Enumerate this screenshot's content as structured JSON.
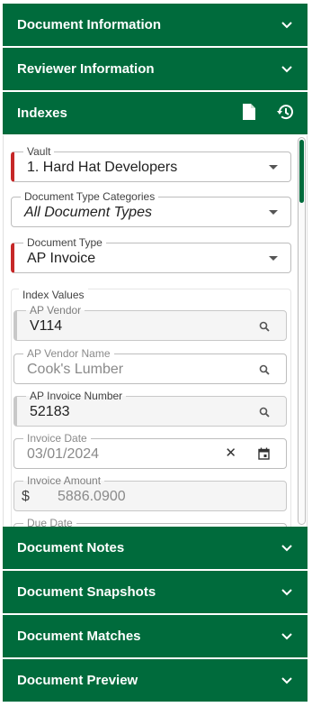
{
  "panels": {
    "document_information": "Document Information",
    "reviewer_information": "Reviewer Information",
    "indexes": "Indexes",
    "document_notes": "Document Notes",
    "document_snapshots": "Document Snapshots",
    "document_matches": "Document Matches",
    "document_preview": "Document Preview"
  },
  "colors": {
    "header_bg": "#006b3c",
    "required_marker": "#c62828"
  },
  "form": {
    "vault": {
      "label": "Vault",
      "value": "1. Hard Hat Developers"
    },
    "doc_type_categories": {
      "label": "Document Type Categories",
      "value": "All Document Types"
    },
    "doc_type": {
      "label": "Document Type",
      "value": "AP Invoice"
    },
    "index_values_label": "Index Values",
    "ap_vendor": {
      "label": "AP Vendor",
      "value": "V114"
    },
    "ap_vendor_name": {
      "label": "AP Vendor Name",
      "value": "Cook's Lumber"
    },
    "ap_invoice_number": {
      "label": "AP Invoice Number",
      "value": "52183"
    },
    "invoice_date": {
      "label": "Invoice Date",
      "value": "03/01/2024",
      "clear": "✕"
    },
    "invoice_amount": {
      "label": "Invoice Amount",
      "currency": "$",
      "value": "5886.0900"
    },
    "due_date": {
      "label": "Due Date"
    }
  }
}
